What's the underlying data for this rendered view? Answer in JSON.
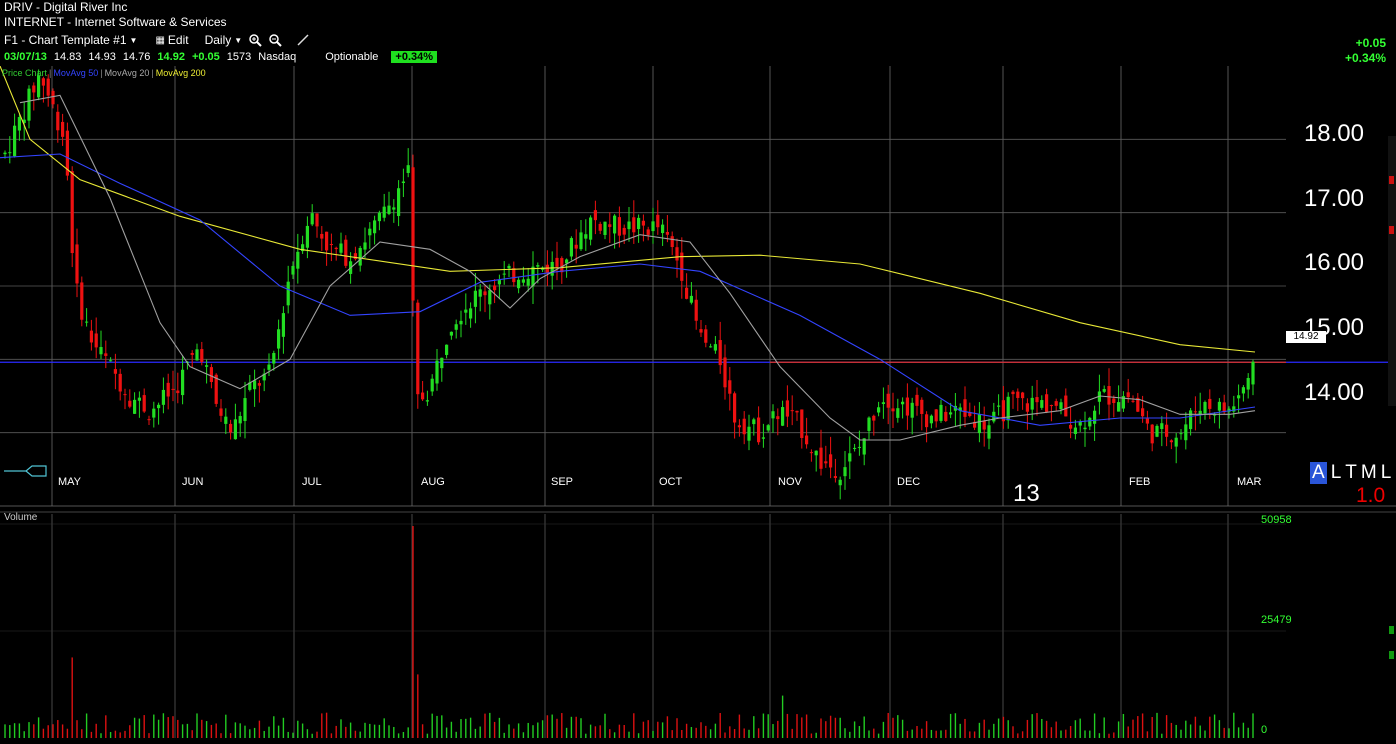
{
  "header": {
    "title": "DRIV  -  Digital River Inc",
    "subtitle": "INTERNET - Internet Software & Services"
  },
  "toolbar": {
    "template": "F1 - Chart Template #1",
    "edit": "Edit",
    "period": "Daily"
  },
  "quote": {
    "date": "03/07/13",
    "open": "14.83",
    "high": "14.93",
    "low": "14.76",
    "last": "14.92",
    "change": "+0.05",
    "volume": "1573",
    "exchange": "Nasdaq",
    "optionable": "Optionable",
    "change_pct": "+0.34%"
  },
  "right_change": {
    "abs": "+0.05",
    "pct": "+0.34%"
  },
  "legend": [
    {
      "label": "Price Chart",
      "color": "#33cc33"
    },
    {
      "label": "MovAvg 50",
      "color": "#3344ff"
    },
    {
      "label": "MovAvg 20",
      "color": "#aaaaaa"
    },
    {
      "label": "MovAvg 200",
      "color": "#eeee33"
    }
  ],
  "price_axis": [
    "18.00",
    "17.00",
    "16.00",
    "15.00",
    "14.00"
  ],
  "price_marker": "14.92",
  "months": [
    "MAY",
    "JUN",
    "JUL",
    "AUG",
    "SEP",
    "OCT",
    "NOV",
    "DEC",
    "FEB",
    "MAR"
  ],
  "year_marker": "13",
  "scale_modes": [
    "A",
    "L",
    "T",
    "M",
    "L"
  ],
  "scale_value": "1.0",
  "volume_panel": {
    "label": "Volume",
    "axis": [
      "50958",
      "25479",
      "0"
    ]
  },
  "chart_data": {
    "type": "candlestick",
    "price_range": [
      13.0,
      19.0
    ],
    "horizontal_line": 14.96,
    "ma200": [
      [
        0,
        19.0
      ],
      [
        30,
        18.0
      ],
      [
        80,
        17.45
      ],
      [
        180,
        16.95
      ],
      [
        300,
        16.5
      ],
      [
        450,
        16.2
      ],
      [
        560,
        16.25
      ],
      [
        680,
        16.4
      ],
      [
        760,
        16.42
      ],
      [
        860,
        16.3
      ],
      [
        980,
        15.9
      ],
      [
        1080,
        15.5
      ],
      [
        1180,
        15.2
      ],
      [
        1255,
        15.1
      ]
    ],
    "ma50": [
      [
        0,
        17.75
      ],
      [
        60,
        17.8
      ],
      [
        120,
        17.4
      ],
      [
        200,
        16.9
      ],
      [
        280,
        16.0
      ],
      [
        350,
        15.6
      ],
      [
        420,
        15.65
      ],
      [
        480,
        16.05
      ],
      [
        560,
        16.2
      ],
      [
        640,
        16.3
      ],
      [
        700,
        16.2
      ],
      [
        800,
        15.6
      ],
      [
        880,
        15.0
      ],
      [
        960,
        14.3
      ],
      [
        1040,
        14.1
      ],
      [
        1120,
        14.2
      ],
      [
        1180,
        14.2
      ],
      [
        1255,
        14.35
      ]
    ],
    "ma20": [
      [
        20,
        18.5
      ],
      [
        60,
        18.6
      ],
      [
        110,
        17.2
      ],
      [
        160,
        15.5
      ],
      [
        190,
        14.9
      ],
      [
        240,
        14.6
      ],
      [
        290,
        15.0
      ],
      [
        330,
        16.0
      ],
      [
        380,
        16.6
      ],
      [
        430,
        16.5
      ],
      [
        470,
        16.2
      ],
      [
        510,
        15.7
      ],
      [
        540,
        16.1
      ],
      [
        580,
        16.4
      ],
      [
        640,
        16.7
      ],
      [
        690,
        16.6
      ],
      [
        730,
        15.9
      ],
      [
        780,
        14.9
      ],
      [
        830,
        14.2
      ],
      [
        860,
        13.9
      ],
      [
        900,
        13.9
      ],
      [
        960,
        14.1
      ],
      [
        1000,
        14.2
      ],
      [
        1060,
        14.3
      ],
      [
        1100,
        14.5
      ],
      [
        1140,
        14.45
      ],
      [
        1180,
        14.25
      ],
      [
        1230,
        14.25
      ],
      [
        1255,
        14.3
      ]
    ],
    "volume_range": [
      0,
      50958
    ]
  }
}
